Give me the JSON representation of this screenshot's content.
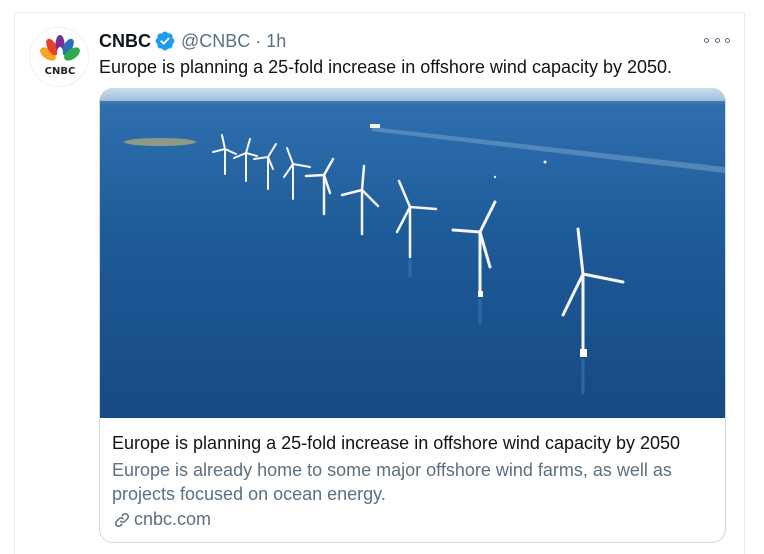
{
  "tweet": {
    "author_name": "CNBC",
    "verified": true,
    "handle": "@CNBC",
    "separator": "·",
    "time": "1h",
    "avatar_text": "CNBC",
    "text": "Europe is planning a 25-fold increase in offshore wind capacity by 2050."
  },
  "card": {
    "title": "Europe is planning a 25-fold increase in offshore wind capacity by 2050",
    "description": "Europe is already home to some major offshore wind farms, as well as projects focused on ocean energy.",
    "domain": "cnbc.com"
  },
  "icons": {
    "verified": "verified-badge-icon",
    "more": "more-options-icon",
    "link": "link-icon"
  },
  "colors": {
    "accent": "#1d9bf0",
    "secondary_text": "#5b7083",
    "border": "#cfd9de"
  }
}
